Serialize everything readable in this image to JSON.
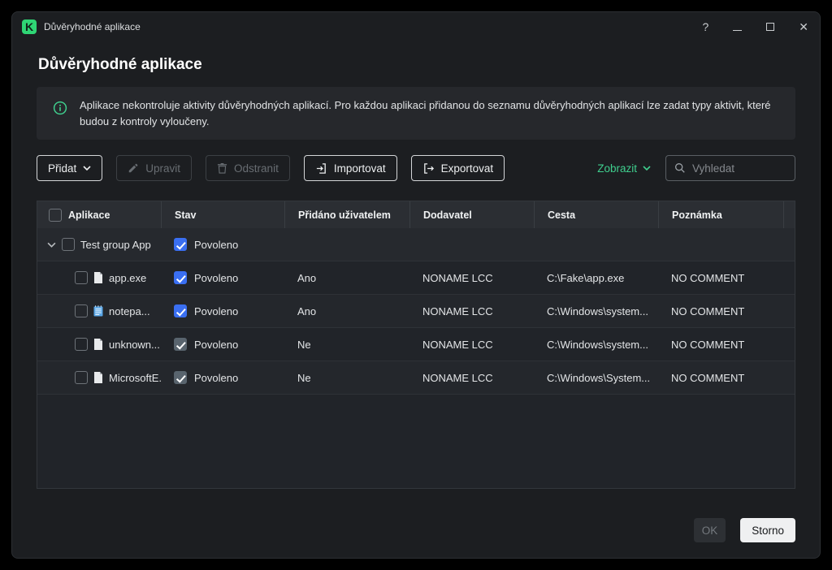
{
  "window": {
    "title": "Důvěryhodné aplikace",
    "controls": {
      "help": "?",
      "close": "✕"
    }
  },
  "page": {
    "title": "Důvěryhodné aplikace"
  },
  "banner": {
    "text": "Aplikace nekontroluje aktivity důvěryhodných aplikací. Pro každou aplikaci přidanou do seznamu důvěryhodných aplikací lze zadat typy aktivit, které budou z kontroly vyloučeny."
  },
  "toolbar": {
    "add_label": "Přidat",
    "edit_label": "Upravit",
    "delete_label": "Odstranit",
    "import_label": "Importovat",
    "export_label": "Exportovat",
    "view_label": "Zobrazit",
    "search_placeholder": "Vyhledat"
  },
  "table": {
    "columns": [
      "Aplikace",
      "Stav",
      "Přidáno uživatelem",
      "Dodavatel",
      "Cesta",
      "Poznámka"
    ],
    "group": {
      "name": "Test group App",
      "status": "Povoleno",
      "expanded": true,
      "enabled": true
    },
    "rows": [
      {
        "name": "app.exe",
        "icon": "file-icon",
        "status": "Povoleno",
        "user_added": "Ano",
        "vendor": "NONAME LCC",
        "path": "C:\\Fake\\app.exe",
        "comment": "NO COMMENT",
        "enabled": true
      },
      {
        "name": "notepa...",
        "icon": "notepad-icon",
        "status": "Povoleno",
        "user_added": "Ano",
        "vendor": "NONAME LCC",
        "path": "C:\\Windows\\system...",
        "comment": "NO COMMENT",
        "enabled": true
      },
      {
        "name": "unknown....",
        "icon": "file-icon",
        "status": "Povoleno",
        "user_added": "Ne",
        "vendor": "NONAME LCC",
        "path": "C:\\Windows\\system...",
        "comment": "NO COMMENT",
        "enabled": false
      },
      {
        "name": "MicrosoftE...",
        "icon": "file-icon",
        "status": "Povoleno",
        "user_added": "Ne",
        "vendor": "NONAME LCC",
        "path": "C:\\Windows\\System...",
        "comment": "NO COMMENT",
        "enabled": false
      }
    ]
  },
  "footer": {
    "ok_label": "OK",
    "cancel_label": "Storno"
  },
  "colors": {
    "accent_green": "#3fcf8e",
    "brand_green": "#2fd575",
    "checkbox_checked": "#3a6ff2",
    "checkbox_muted": "#59646e",
    "window_bg": "#1c1e21",
    "banner_bg": "#26282c",
    "table_header_bg": "#2b2e33"
  }
}
